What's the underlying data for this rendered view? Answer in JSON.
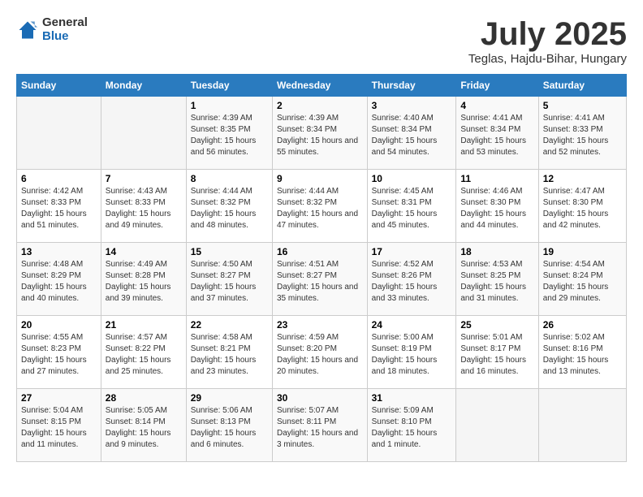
{
  "header": {
    "logo_general": "General",
    "logo_blue": "Blue",
    "month_title": "July 2025",
    "subtitle": "Teglas, Hajdu-Bihar, Hungary"
  },
  "days_of_week": [
    "Sunday",
    "Monday",
    "Tuesday",
    "Wednesday",
    "Thursday",
    "Friday",
    "Saturday"
  ],
  "weeks": [
    [
      {
        "day": "",
        "sunrise": "",
        "sunset": "",
        "daylight": ""
      },
      {
        "day": "",
        "sunrise": "",
        "sunset": "",
        "daylight": ""
      },
      {
        "day": "1",
        "sunrise": "Sunrise: 4:39 AM",
        "sunset": "Sunset: 8:35 PM",
        "daylight": "Daylight: 15 hours and 56 minutes."
      },
      {
        "day": "2",
        "sunrise": "Sunrise: 4:39 AM",
        "sunset": "Sunset: 8:34 PM",
        "daylight": "Daylight: 15 hours and 55 minutes."
      },
      {
        "day": "3",
        "sunrise": "Sunrise: 4:40 AM",
        "sunset": "Sunset: 8:34 PM",
        "daylight": "Daylight: 15 hours and 54 minutes."
      },
      {
        "day": "4",
        "sunrise": "Sunrise: 4:41 AM",
        "sunset": "Sunset: 8:34 PM",
        "daylight": "Daylight: 15 hours and 53 minutes."
      },
      {
        "day": "5",
        "sunrise": "Sunrise: 4:41 AM",
        "sunset": "Sunset: 8:33 PM",
        "daylight": "Daylight: 15 hours and 52 minutes."
      }
    ],
    [
      {
        "day": "6",
        "sunrise": "Sunrise: 4:42 AM",
        "sunset": "Sunset: 8:33 PM",
        "daylight": "Daylight: 15 hours and 51 minutes."
      },
      {
        "day": "7",
        "sunrise": "Sunrise: 4:43 AM",
        "sunset": "Sunset: 8:33 PM",
        "daylight": "Daylight: 15 hours and 49 minutes."
      },
      {
        "day": "8",
        "sunrise": "Sunrise: 4:44 AM",
        "sunset": "Sunset: 8:32 PM",
        "daylight": "Daylight: 15 hours and 48 minutes."
      },
      {
        "day": "9",
        "sunrise": "Sunrise: 4:44 AM",
        "sunset": "Sunset: 8:32 PM",
        "daylight": "Daylight: 15 hours and 47 minutes."
      },
      {
        "day": "10",
        "sunrise": "Sunrise: 4:45 AM",
        "sunset": "Sunset: 8:31 PM",
        "daylight": "Daylight: 15 hours and 45 minutes."
      },
      {
        "day": "11",
        "sunrise": "Sunrise: 4:46 AM",
        "sunset": "Sunset: 8:30 PM",
        "daylight": "Daylight: 15 hours and 44 minutes."
      },
      {
        "day": "12",
        "sunrise": "Sunrise: 4:47 AM",
        "sunset": "Sunset: 8:30 PM",
        "daylight": "Daylight: 15 hours and 42 minutes."
      }
    ],
    [
      {
        "day": "13",
        "sunrise": "Sunrise: 4:48 AM",
        "sunset": "Sunset: 8:29 PM",
        "daylight": "Daylight: 15 hours and 40 minutes."
      },
      {
        "day": "14",
        "sunrise": "Sunrise: 4:49 AM",
        "sunset": "Sunset: 8:28 PM",
        "daylight": "Daylight: 15 hours and 39 minutes."
      },
      {
        "day": "15",
        "sunrise": "Sunrise: 4:50 AM",
        "sunset": "Sunset: 8:27 PM",
        "daylight": "Daylight: 15 hours and 37 minutes."
      },
      {
        "day": "16",
        "sunrise": "Sunrise: 4:51 AM",
        "sunset": "Sunset: 8:27 PM",
        "daylight": "Daylight: 15 hours and 35 minutes."
      },
      {
        "day": "17",
        "sunrise": "Sunrise: 4:52 AM",
        "sunset": "Sunset: 8:26 PM",
        "daylight": "Daylight: 15 hours and 33 minutes."
      },
      {
        "day": "18",
        "sunrise": "Sunrise: 4:53 AM",
        "sunset": "Sunset: 8:25 PM",
        "daylight": "Daylight: 15 hours and 31 minutes."
      },
      {
        "day": "19",
        "sunrise": "Sunrise: 4:54 AM",
        "sunset": "Sunset: 8:24 PM",
        "daylight": "Daylight: 15 hours and 29 minutes."
      }
    ],
    [
      {
        "day": "20",
        "sunrise": "Sunrise: 4:55 AM",
        "sunset": "Sunset: 8:23 PM",
        "daylight": "Daylight: 15 hours and 27 minutes."
      },
      {
        "day": "21",
        "sunrise": "Sunrise: 4:57 AM",
        "sunset": "Sunset: 8:22 PM",
        "daylight": "Daylight: 15 hours and 25 minutes."
      },
      {
        "day": "22",
        "sunrise": "Sunrise: 4:58 AM",
        "sunset": "Sunset: 8:21 PM",
        "daylight": "Daylight: 15 hours and 23 minutes."
      },
      {
        "day": "23",
        "sunrise": "Sunrise: 4:59 AM",
        "sunset": "Sunset: 8:20 PM",
        "daylight": "Daylight: 15 hours and 20 minutes."
      },
      {
        "day": "24",
        "sunrise": "Sunrise: 5:00 AM",
        "sunset": "Sunset: 8:19 PM",
        "daylight": "Daylight: 15 hours and 18 minutes."
      },
      {
        "day": "25",
        "sunrise": "Sunrise: 5:01 AM",
        "sunset": "Sunset: 8:17 PM",
        "daylight": "Daylight: 15 hours and 16 minutes."
      },
      {
        "day": "26",
        "sunrise": "Sunrise: 5:02 AM",
        "sunset": "Sunset: 8:16 PM",
        "daylight": "Daylight: 15 hours and 13 minutes."
      }
    ],
    [
      {
        "day": "27",
        "sunrise": "Sunrise: 5:04 AM",
        "sunset": "Sunset: 8:15 PM",
        "daylight": "Daylight: 15 hours and 11 minutes."
      },
      {
        "day": "28",
        "sunrise": "Sunrise: 5:05 AM",
        "sunset": "Sunset: 8:14 PM",
        "daylight": "Daylight: 15 hours and 9 minutes."
      },
      {
        "day": "29",
        "sunrise": "Sunrise: 5:06 AM",
        "sunset": "Sunset: 8:13 PM",
        "daylight": "Daylight: 15 hours and 6 minutes."
      },
      {
        "day": "30",
        "sunrise": "Sunrise: 5:07 AM",
        "sunset": "Sunset: 8:11 PM",
        "daylight": "Daylight: 15 hours and 3 minutes."
      },
      {
        "day": "31",
        "sunrise": "Sunrise: 5:09 AM",
        "sunset": "Sunset: 8:10 PM",
        "daylight": "Daylight: 15 hours and 1 minute."
      },
      {
        "day": "",
        "sunrise": "",
        "sunset": "",
        "daylight": ""
      },
      {
        "day": "",
        "sunrise": "",
        "sunset": "",
        "daylight": ""
      }
    ]
  ]
}
